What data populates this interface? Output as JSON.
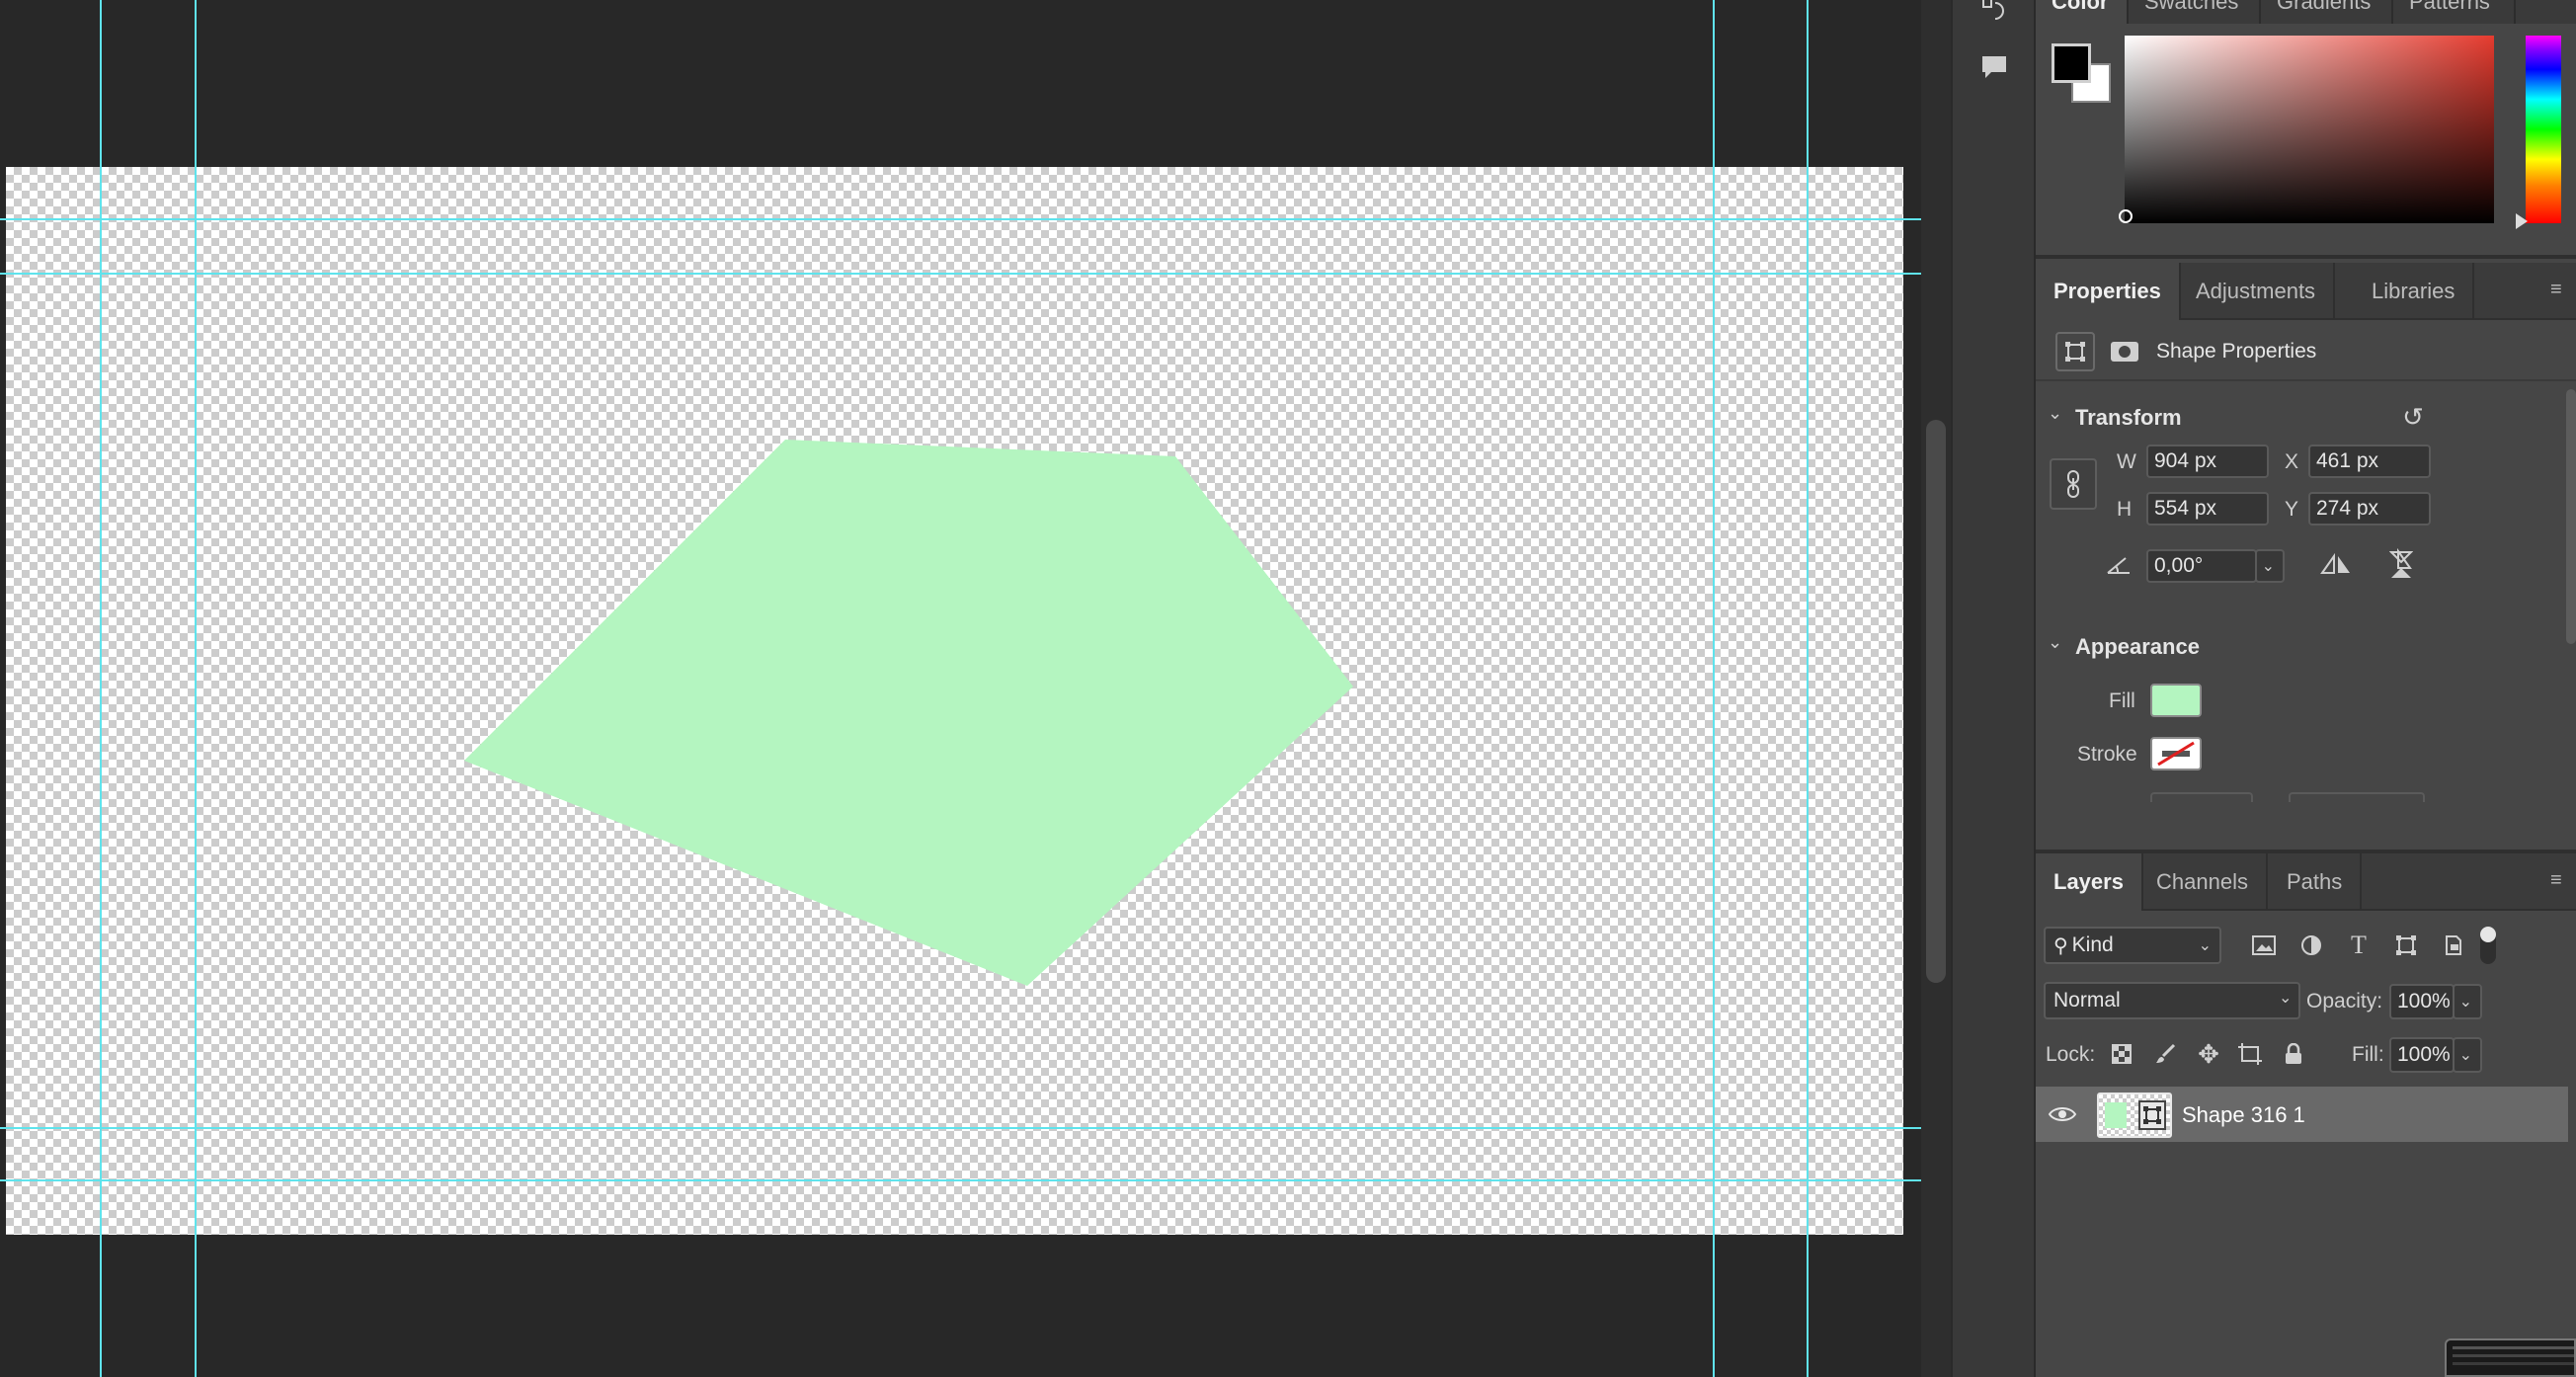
{
  "canvas": {
    "shape_fill": "#b4f5c0",
    "guide_color": "#5fe3ec"
  },
  "color_panel": {
    "tabs": [
      "Color",
      "Swatches",
      "Gradients",
      "Patterns"
    ],
    "foreground": "#000000",
    "background": "#ffffff"
  },
  "properties": {
    "tabs": [
      "Properties",
      "Adjustments",
      "Libraries"
    ],
    "header": "Shape Properties",
    "transform": {
      "title": "Transform",
      "w_label": "W",
      "w_value": "904 px",
      "h_label": "H",
      "h_value": "554 px",
      "x_label": "X",
      "x_value": "461 px",
      "y_label": "Y",
      "y_value": "274 px",
      "angle_value": "0,00°"
    },
    "appearance": {
      "title": "Appearance",
      "fill_label": "Fill",
      "fill_color": "#b4f5c0",
      "stroke_label": "Stroke"
    }
  },
  "layers": {
    "tabs": [
      "Layers",
      "Channels",
      "Paths"
    ],
    "filter_kind": "Kind",
    "blend_mode": "Normal",
    "opacity_label": "Opacity:",
    "opacity_value": "100%",
    "lock_label": "Lock:",
    "fill_label": "Fill:",
    "fill_value": "100%",
    "items": [
      {
        "name": "Shape 316 1"
      }
    ]
  }
}
